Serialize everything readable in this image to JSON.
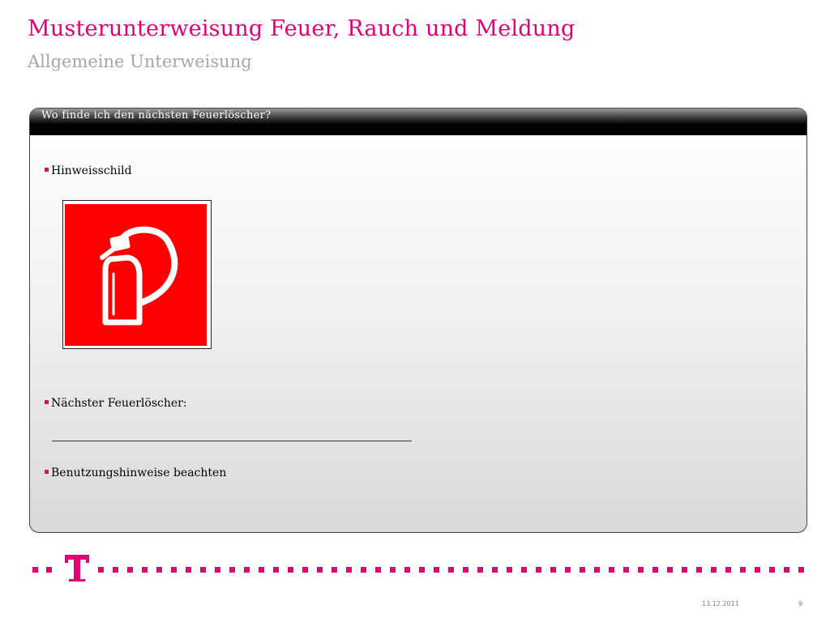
{
  "slide": {
    "title": "Musterunterweisung Feuer, Rauch und Meldung",
    "subtitle": "Allgemeine Unterweisung"
  },
  "panel": {
    "header": "Wo finde ich den nächsten Feuerlöscher?",
    "bullets": [
      {
        "label": "Hinweisschild"
      },
      {
        "label": "Nächster Feuerlöscher:"
      },
      {
        "label": "Benutzungshinweise beachten"
      }
    ],
    "sign_icon": "fire-extinguisher-sign",
    "sign_color": "#ff0000"
  },
  "footer": {
    "logo": "telekom-t-logo",
    "brand_color": "#e20074",
    "date": "13.12.2011",
    "page": "9"
  }
}
